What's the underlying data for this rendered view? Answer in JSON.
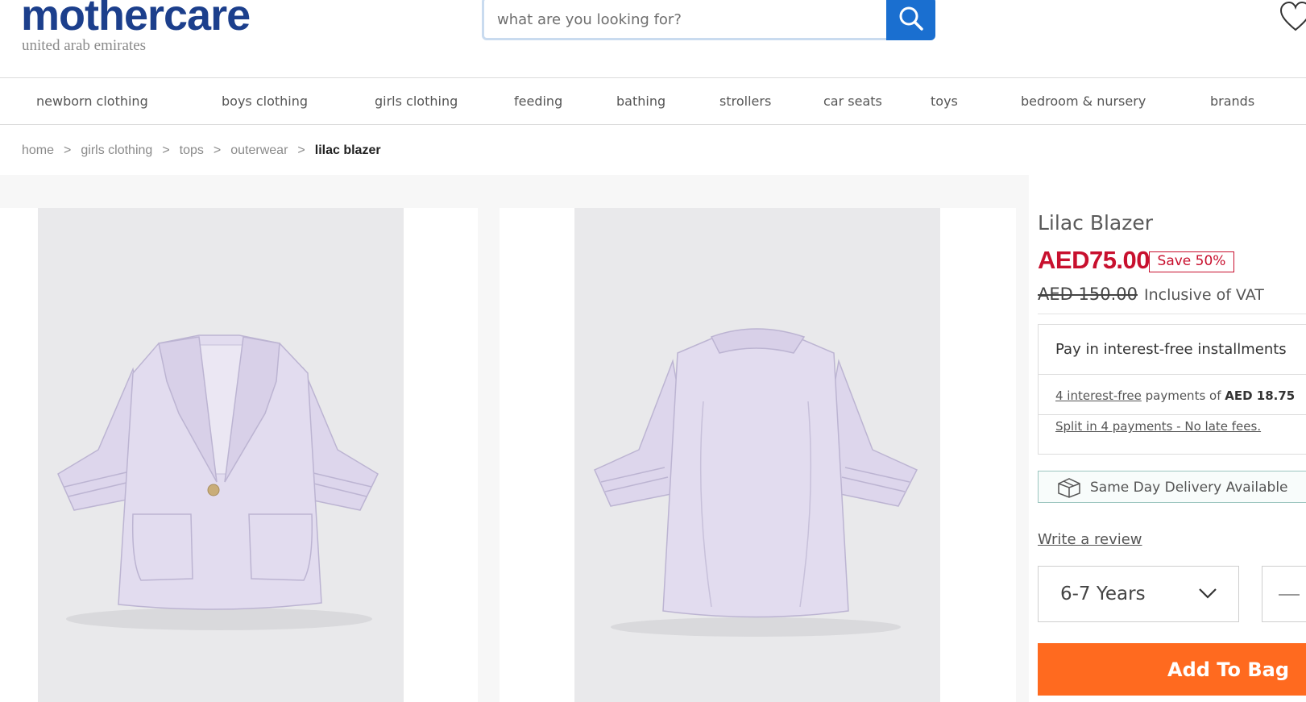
{
  "header": {
    "logo": "mothercare",
    "logo_sub": "united arab emirates",
    "search_placeholder": "what are you looking for?",
    "search_icon": "search-icon",
    "wishlist_icon": "heart-icon"
  },
  "nav": {
    "items": [
      "newborn clothing",
      "boys clothing",
      "girls clothing",
      "feeding",
      "bathing",
      "strollers",
      "car seats",
      "toys",
      "bedroom & nursery",
      "brands"
    ]
  },
  "breadcrumb": {
    "items": [
      "home",
      "girls clothing",
      "tops",
      "outerwear"
    ],
    "separator": ">",
    "current": "lilac blazer"
  },
  "product": {
    "title": "Lilac Blazer",
    "price": "AED75.00",
    "save_badge": "Save 50%",
    "old_price": "AED 150.00",
    "vat_note": "Inclusive of VAT",
    "installments": {
      "title": "Pay in interest-free installments",
      "link_text": "4 interest-free",
      "mid_text": " payments of ",
      "amount": "AED 18.75",
      "split_text": "Split in 4 payments - No late fees."
    },
    "delivery": {
      "icon": "box-icon",
      "text": "Same Day Delivery Available"
    },
    "review_link": "Write a review",
    "size": {
      "selected": "6-7 Years",
      "icon": "chevron-down-icon"
    },
    "quantity_icon": "minus-icon",
    "add_to_bag": "Add To Bag"
  },
  "gallery": {
    "images": [
      "lilac-blazer-front",
      "lilac-blazer-back"
    ]
  },
  "colors": {
    "brand_blue": "#1c3f8c",
    "search_button": "#1a6fd0",
    "price_red": "#c8102e",
    "cta_orange": "#ff6a1f",
    "blazer_lilac": "#ddd6ec"
  }
}
